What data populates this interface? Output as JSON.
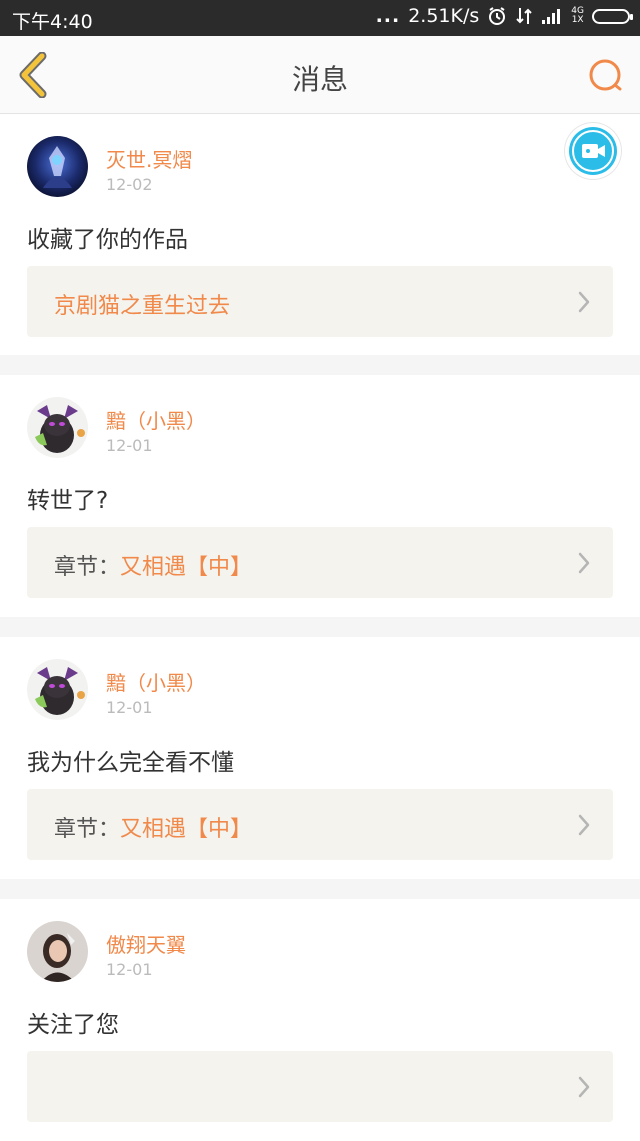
{
  "status_bar": {
    "time": "下午4:40",
    "dots": "...",
    "network_speed": "2.51K/s",
    "net_top": "4G",
    "net_bottom": "1X"
  },
  "header": {
    "title": "消息"
  },
  "colors": {
    "accent": "#f0894a",
    "back_arrow": "#f3c43b",
    "camera": "#2bbde8"
  },
  "messages": [
    {
      "user": "灭世.冥熠",
      "date": "12-02",
      "text": "收藏了你的作品",
      "ref_prefix": "",
      "ref_title": "京剧猫之重生过去"
    },
    {
      "user": "黯（小黑）",
      "date": "12-01",
      "text": "转世了?",
      "ref_prefix": "章节：",
      "ref_title": "又相遇【中】"
    },
    {
      "user": "黯（小黑）",
      "date": "12-01",
      "text": "我为什么完全看不懂",
      "ref_prefix": "章节：",
      "ref_title": "又相遇【中】"
    },
    {
      "user": "傲翔天翼",
      "date": "12-01",
      "text": "关注了您",
      "ref_prefix": "",
      "ref_title": ""
    }
  ]
}
